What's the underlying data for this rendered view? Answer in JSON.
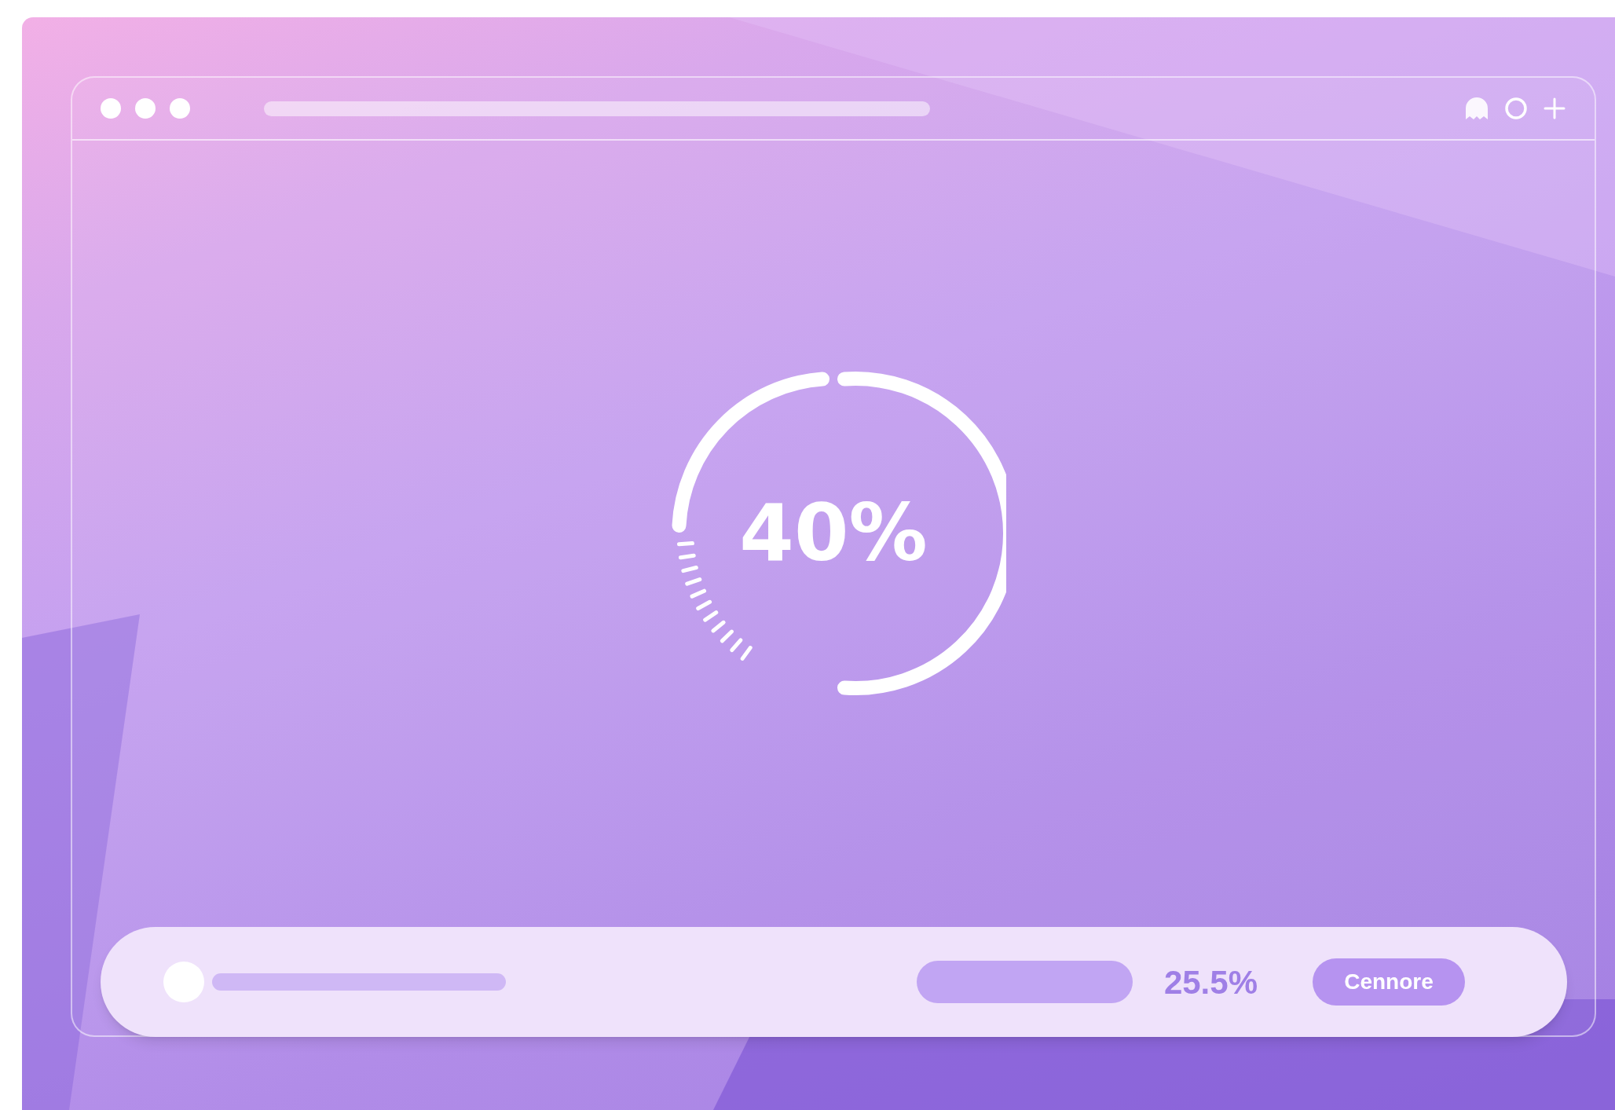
{
  "progress": {
    "percent": "40%"
  },
  "bottom_bar": {
    "reading": "25.5%",
    "button": "Cennore"
  }
}
